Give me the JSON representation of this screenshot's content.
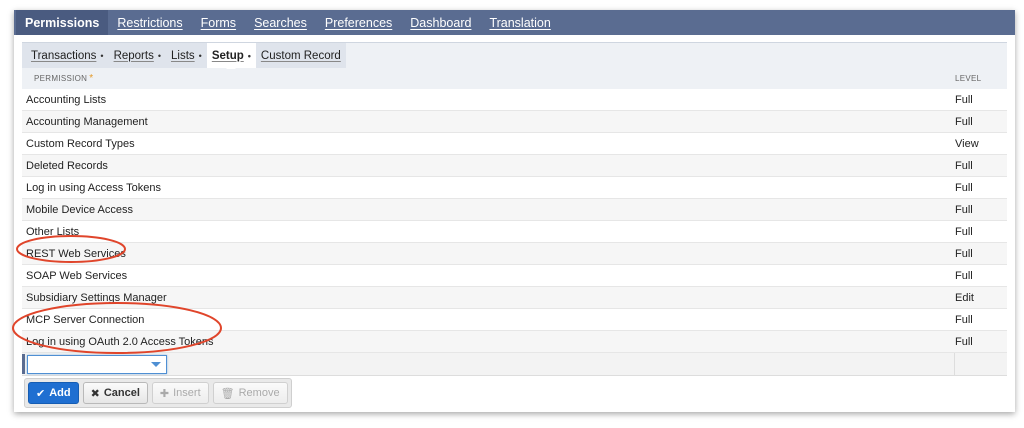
{
  "top_tabs": [
    {
      "label": "Permissions",
      "active": true
    },
    {
      "label": "Restrictions",
      "active": false
    },
    {
      "label": "Forms",
      "active": false
    },
    {
      "label": "Searches",
      "active": false
    },
    {
      "label": "Preferences",
      "active": false
    },
    {
      "label": "Dashboard",
      "active": false
    },
    {
      "label": "Translation",
      "active": false
    }
  ],
  "sub_tabs": [
    {
      "label": "Transactions",
      "dot": "•"
    },
    {
      "label": "Reports",
      "dot": "•"
    },
    {
      "label": "Lists",
      "dot": "•"
    },
    {
      "label": "Setup",
      "dot": "•",
      "active": true
    },
    {
      "label": "Custom Record",
      "dot": ""
    }
  ],
  "table": {
    "header_permission": "PERMISSION",
    "required_mark": "*",
    "header_level": "LEVEL",
    "rows": [
      {
        "permission": "Accounting Lists",
        "level": "Full"
      },
      {
        "permission": "Accounting Management",
        "level": "Full"
      },
      {
        "permission": "Custom Record Types",
        "level": "View"
      },
      {
        "permission": "Deleted Records",
        "level": "Full"
      },
      {
        "permission": "Log in using Access Tokens",
        "level": "Full"
      },
      {
        "permission": "Mobile Device Access",
        "level": "Full"
      },
      {
        "permission": "Other Lists",
        "level": "Full"
      },
      {
        "permission": "REST Web Services",
        "level": "Full"
      },
      {
        "permission": "SOAP Web Services",
        "level": "Full"
      },
      {
        "permission": "Subsidiary Settings Manager",
        "level": "Edit"
      },
      {
        "permission": "MCP Server Connection",
        "level": "Full"
      },
      {
        "permission": "Log in using OAuth 2.0 Access Tokens",
        "level": "Full"
      }
    ]
  },
  "edit_row": {
    "select_value": ""
  },
  "buttons": {
    "add": "Add",
    "cancel": "Cancel",
    "insert": "Insert",
    "remove": "Remove"
  },
  "annotation_color": "#e0452b",
  "colors": {
    "header_bar": "#5a6c91",
    "primary_button": "#1f6fd1"
  }
}
